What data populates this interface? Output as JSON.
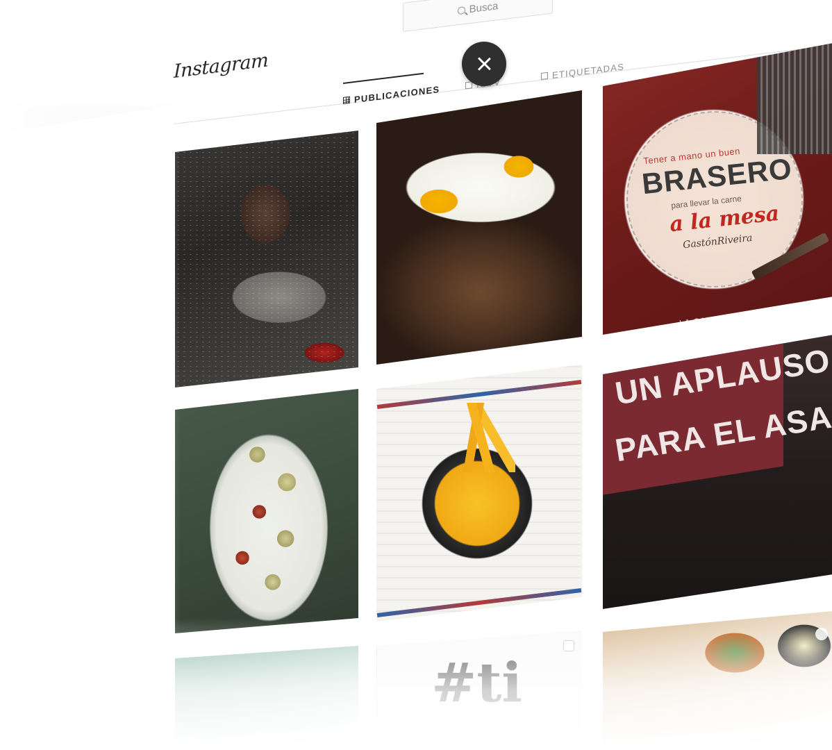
{
  "search": {
    "placeholder": "Busca",
    "icon": "search-icon"
  },
  "header": {
    "logo_text": "Instagram"
  },
  "tabs": [
    {
      "label": "PUBLICACIONES",
      "active": true,
      "icon": "grid-icon"
    },
    {
      "label": "IGTV",
      "active": false,
      "icon": "tv-icon"
    },
    {
      "label": "ETIQUETADAS",
      "active": false,
      "icon": "tag-icon"
    }
  ],
  "close_button": {
    "icon": "close-icon"
  },
  "posts": {
    "brasero": {
      "line1": "Tener a mano un buen",
      "line2": "BRASERO",
      "line3": "para llevar la carne",
      "line4": "a la mesa",
      "signature": "GastónRiveira",
      "corner": "LA CABRERA"
    },
    "aplauso": {
      "line1": "UN APLAUSO...",
      "line2": "PARA EL ASADOR"
    },
    "hashtag": {
      "text": "#ti"
    }
  },
  "colors": {
    "accent_dark": "#262626",
    "muted": "#8e8e8e",
    "close_bg": "#2f2f2f"
  }
}
